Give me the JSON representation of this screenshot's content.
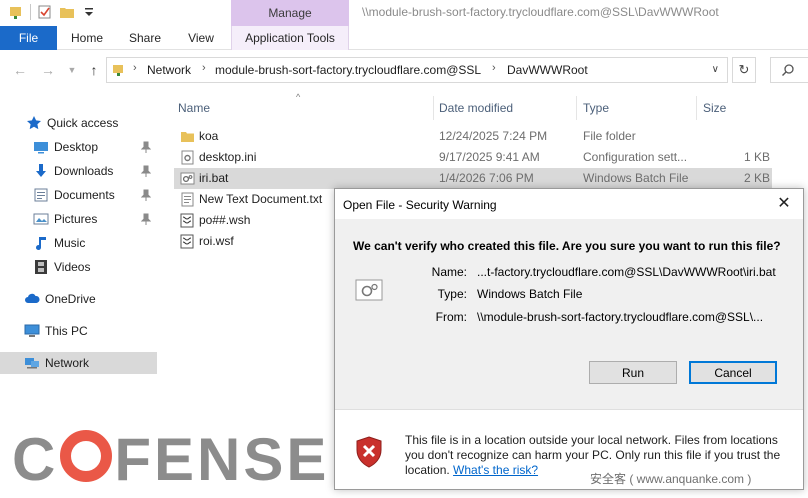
{
  "window": {
    "manage_tab": "Manage",
    "title_path": "\\\\module-brush-sort-factory.trycloudflare.com@SSL\\DavWWWRoot"
  },
  "ribbon": {
    "file": "File",
    "home": "Home",
    "share": "Share",
    "view": "View",
    "app_tools": "Application Tools"
  },
  "address": {
    "crumbs": [
      "Network",
      "module-brush-sort-factory.trycloudflare.com@SSL",
      "DavWWWRoot"
    ]
  },
  "sidebar": {
    "items": [
      {
        "label": "Quick access",
        "icon": "star-icon"
      },
      {
        "label": "Desktop",
        "icon": "desktop-folder-icon",
        "pinned": true
      },
      {
        "label": "Downloads",
        "icon": "download-arrow-icon",
        "pinned": true
      },
      {
        "label": "Documents",
        "icon": "documents-icon",
        "pinned": true
      },
      {
        "label": "Pictures",
        "icon": "pictures-icon",
        "pinned": true
      },
      {
        "label": "Music",
        "icon": "music-note-icon"
      },
      {
        "label": "Videos",
        "icon": "film-icon"
      },
      {
        "label": "OneDrive",
        "icon": "cloud-icon"
      },
      {
        "label": "This PC",
        "icon": "computer-icon"
      },
      {
        "label": "Network",
        "icon": "network-icon"
      }
    ]
  },
  "columns": {
    "name": "Name",
    "date": "Date modified",
    "type": "Type",
    "size": "Size"
  },
  "files": [
    {
      "name": "koa",
      "date": "12/24/2025 7:24 PM",
      "type": "File folder",
      "size": "",
      "icon": "folder-icon"
    },
    {
      "name": "desktop.ini",
      "date": "9/17/2025 9:41 AM",
      "type": "Configuration sett...",
      "size": "1 KB",
      "icon": "settings-file-icon"
    },
    {
      "name": "iri.bat",
      "date": "1/4/2026 7:06 PM",
      "type": "Windows Batch File",
      "size": "2 KB",
      "icon": "batch-file-icon"
    },
    {
      "name": "New Text Document.txt",
      "date": "",
      "type": "",
      "size": "",
      "icon": "text-file-icon"
    },
    {
      "name": "po##.wsh",
      "date": "",
      "type": "",
      "size": "",
      "icon": "script-file-icon"
    },
    {
      "name": "roi.wsf",
      "date": "",
      "type": "",
      "size": "",
      "icon": "script-file-icon"
    }
  ],
  "dialog": {
    "title": "Open File - Security Warning",
    "question": "We can't verify who created this file. Are you sure you want to run this file?",
    "name_label": "Name:",
    "name_value": "...t-factory.trycloudflare.com@SSL\\DavWWWRoot\\iri.bat",
    "type_label": "Type:",
    "type_value": "Windows Batch File",
    "from_label": "From:",
    "from_value": "\\\\module-brush-sort-factory.trycloudflare.com@SSL\\...",
    "run": "Run",
    "cancel": "Cancel",
    "footer_text": "This file is in a location outside your local network. Files from locations you don't recognize can harm your PC. Only run this file if you trust the location.",
    "footer_link": "What's the risk?"
  },
  "watermarks": {
    "cofense_pre": "C",
    "cofense_post": "FENSE",
    "anquanke": "安全客 ( www.anquanke.com )"
  },
  "colors": {
    "file_tab": "#1b6ac9",
    "manage_tab": "#dcc4ec",
    "selected_row": "#d9d9d9",
    "link": "#0066cc",
    "cofense_o": "#e8422e"
  }
}
